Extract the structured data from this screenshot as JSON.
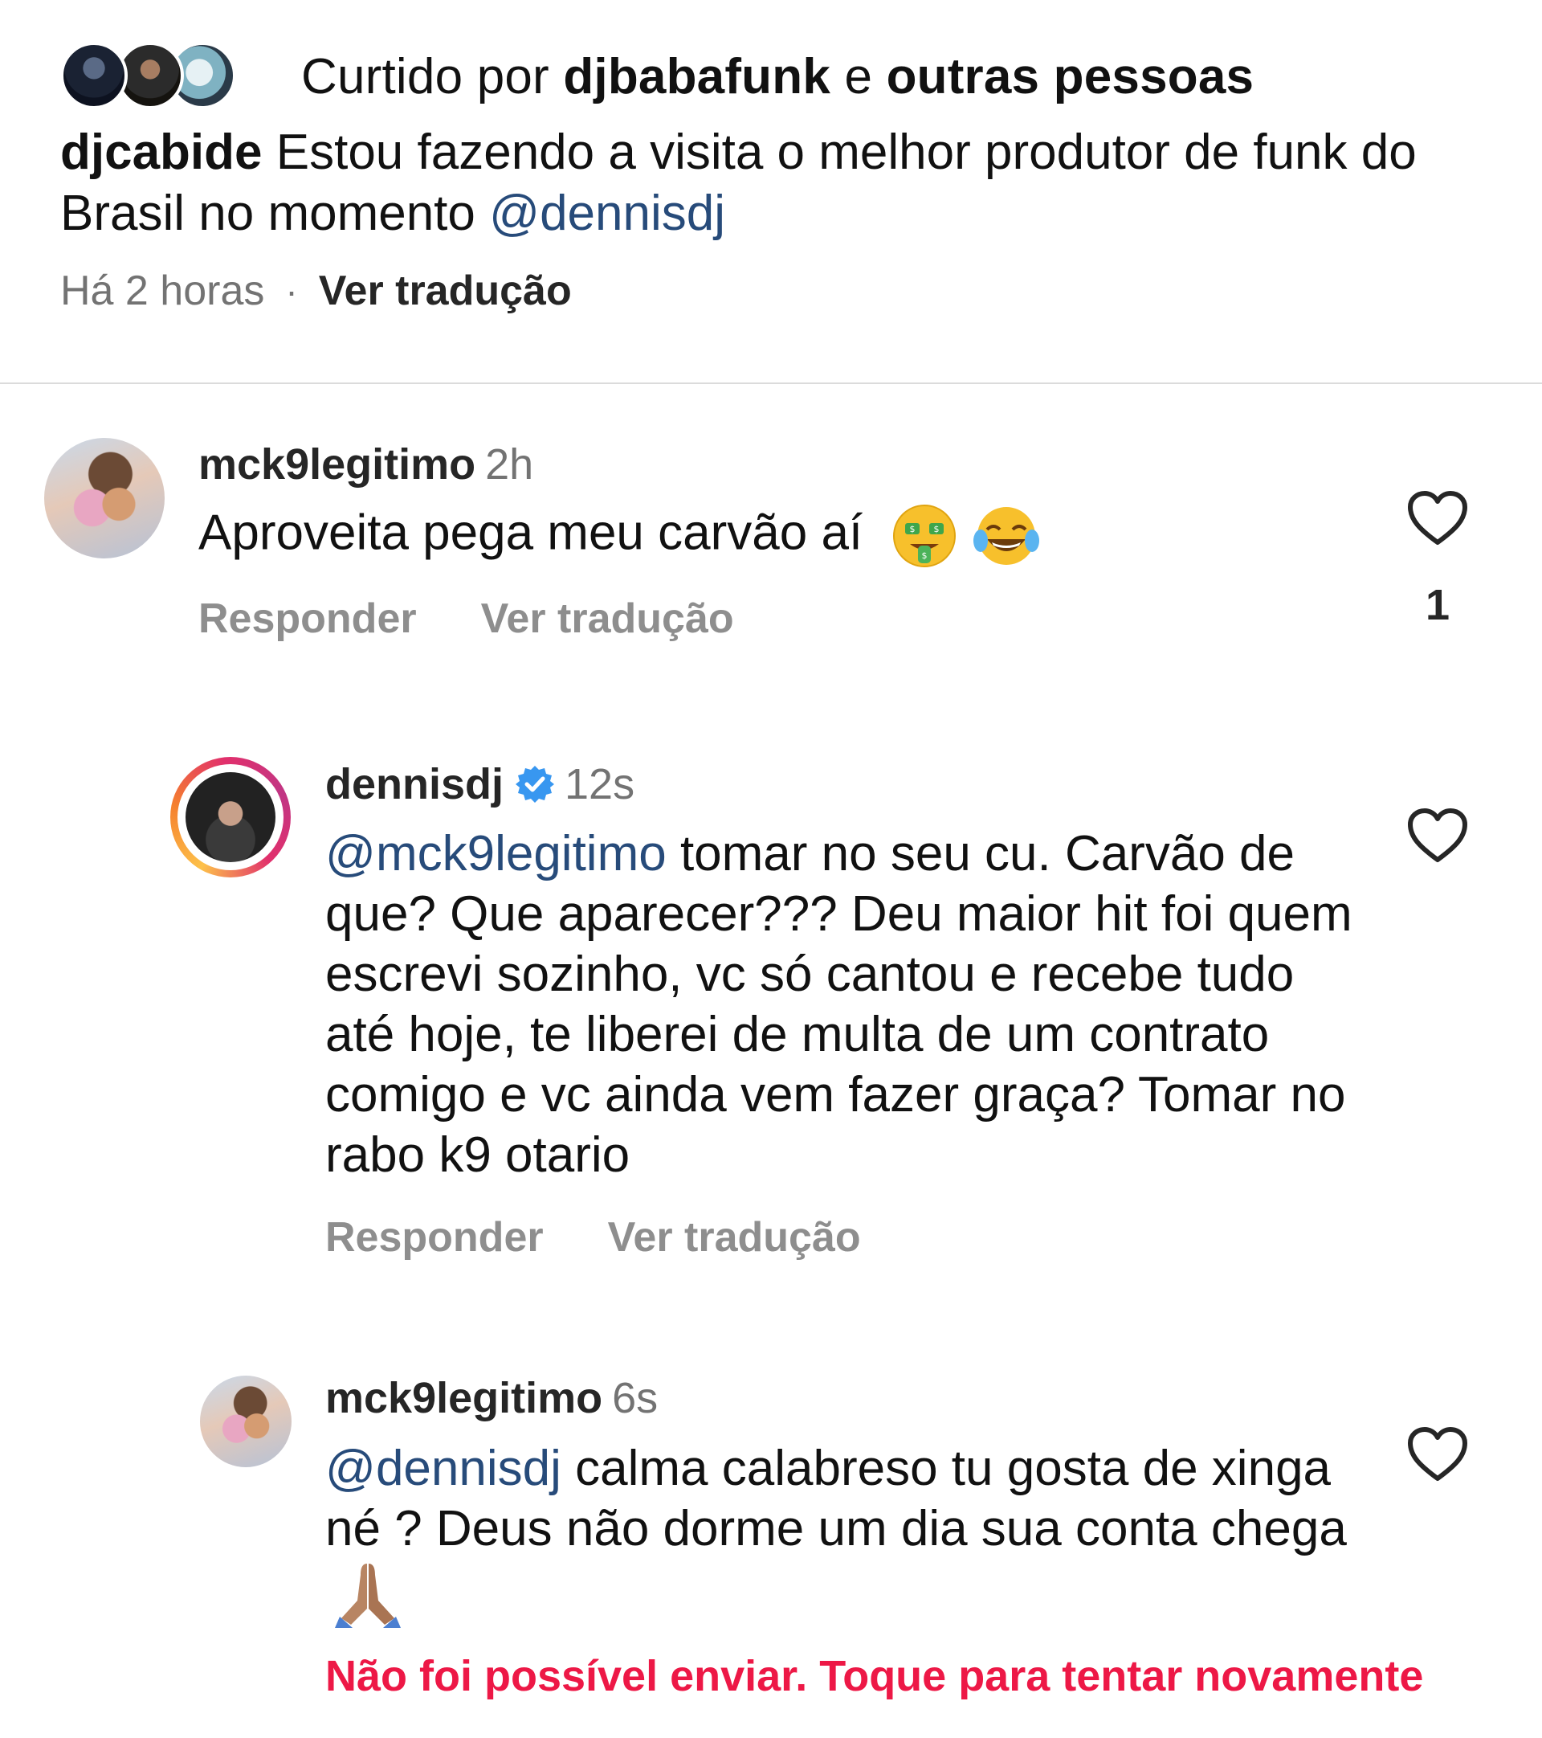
{
  "post": {
    "liked_by_prefix": "Curtido por ",
    "liked_by_user": "djbabafunk",
    "liked_by_mid": " e ",
    "liked_by_others": "outras pessoas",
    "author": "djcabide",
    "caption_text": " Estou fazendo a visita  o melhor produtor de funk do Brasil no momento  ",
    "caption_mention": "@dennisdj",
    "time": "Há 2 horas",
    "separator": "·",
    "translate_label": "Ver tradução"
  },
  "comments": [
    {
      "username": "mck9legitimo",
      "time": "2h",
      "text": "Aproveita pega meu carvão aí ",
      "emojis": [
        "money-mouth-face",
        "face-with-tears-of-joy"
      ],
      "reply_label": "Responder",
      "translate_label": "Ver tradução",
      "like_count": "1"
    },
    {
      "username": "dennisdj",
      "verified": true,
      "time": "12s",
      "mention": "@mck9legitimo",
      "text": " tomar no seu cu. Carvão de que? Que aparecer??? Deu maior hit foi quem escrevi sozinho, vc só cantou e recebe tudo até hoje, te liberei de multa de um contrato comigo e vc ainda vem fazer graça? Tomar no rabo k9 otario",
      "reply_label": "Responder",
      "translate_label": "Ver tradução"
    },
    {
      "username": "mck9legitimo",
      "time": "6s",
      "mention": "@dennisdj",
      "text": " calma calabreso tu gosta de xinga né ? Deus não dorme um dia sua conta chega ",
      "emojis": [
        "folded-hands"
      ],
      "error": "Não foi possível enviar. Toque para tentar novamente"
    }
  ],
  "colors": {
    "mention": "#274b7a",
    "error": "#ed1846",
    "meta_gray": "#737373",
    "verified_blue": "#3897f0"
  }
}
